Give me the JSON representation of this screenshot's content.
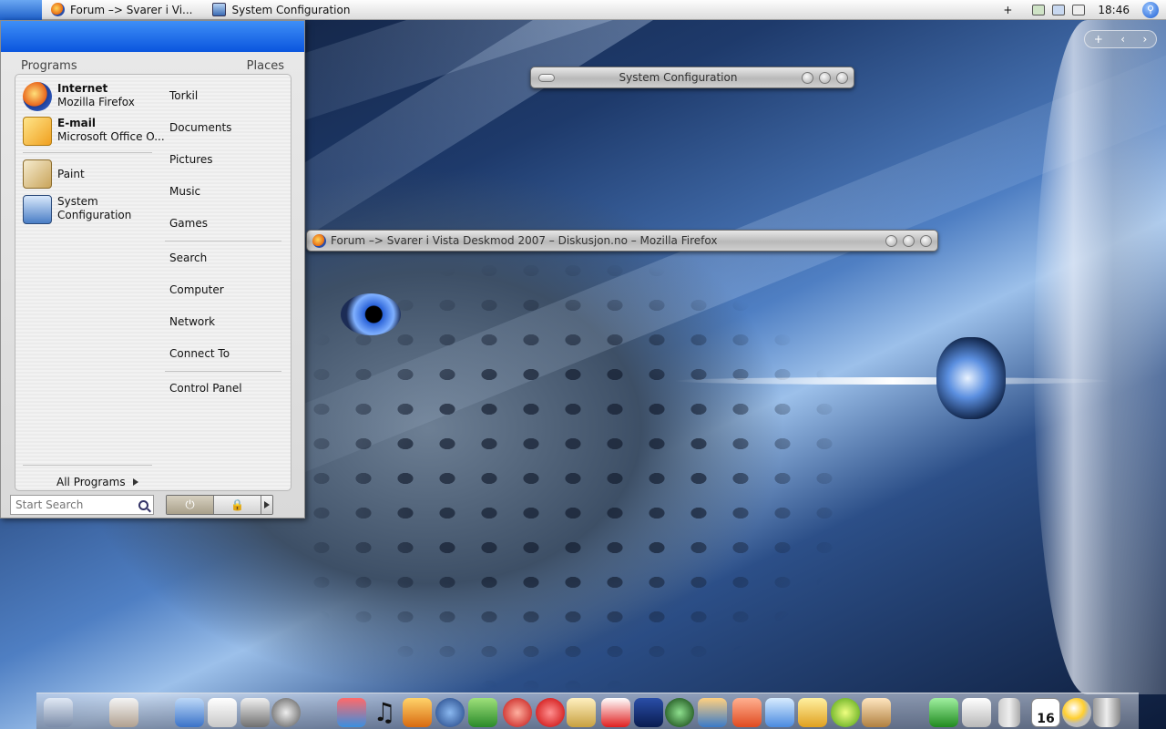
{
  "menubar": {
    "tasks": [
      {
        "label": "Forum –> Svarer i Vi..."
      },
      {
        "label": "System Configuration"
      }
    ],
    "plus": "+",
    "clock": "18:46"
  },
  "startmenu": {
    "tab_programs": "Programs",
    "tab_places": "Places",
    "pinned": [
      {
        "title": "Internet",
        "subtitle": "Mozilla Firefox"
      },
      {
        "title": "E-mail",
        "subtitle": "Microsoft Office O..."
      }
    ],
    "recent": [
      {
        "label": "Paint"
      },
      {
        "label": "System Configuration"
      }
    ],
    "places": [
      "Torkil",
      "Documents",
      "Pictures",
      "Music",
      "Games",
      "Search",
      "Computer",
      "Network",
      "Connect To",
      "Control Panel"
    ],
    "all_programs": "All Programs",
    "search_placeholder": "Start Search"
  },
  "windows": {
    "sysconfig_title": "System Configuration",
    "firefox_title": "Forum –> Svarer i Vista Deskmod 2007 – Diskusjon.no – Mozilla Firefox"
  },
  "widget_bar": {
    "add": "+",
    "prev": "‹",
    "next": "›"
  },
  "dock": {
    "calendar_day": "16",
    "icons": [
      "tool-icon",
      "home-icon",
      "finder-icon",
      "textedit-icon",
      "preview-icon",
      "speaker-icon",
      "dashboard-icon",
      "music-icon",
      "safari-icon",
      "network-icon",
      "green-icon",
      "fire-icon",
      "power-icon",
      "house-icon",
      "mario-icon",
      "pga-icon",
      "radar-icon",
      "compass-icon",
      "p-icon",
      "word-icon",
      "office-icon",
      "ball-icon",
      "paint-icon",
      "croc-icon",
      "mac-icon",
      "battery-icon",
      "calendar-icon",
      "weather-icon",
      "trash-icon"
    ]
  }
}
